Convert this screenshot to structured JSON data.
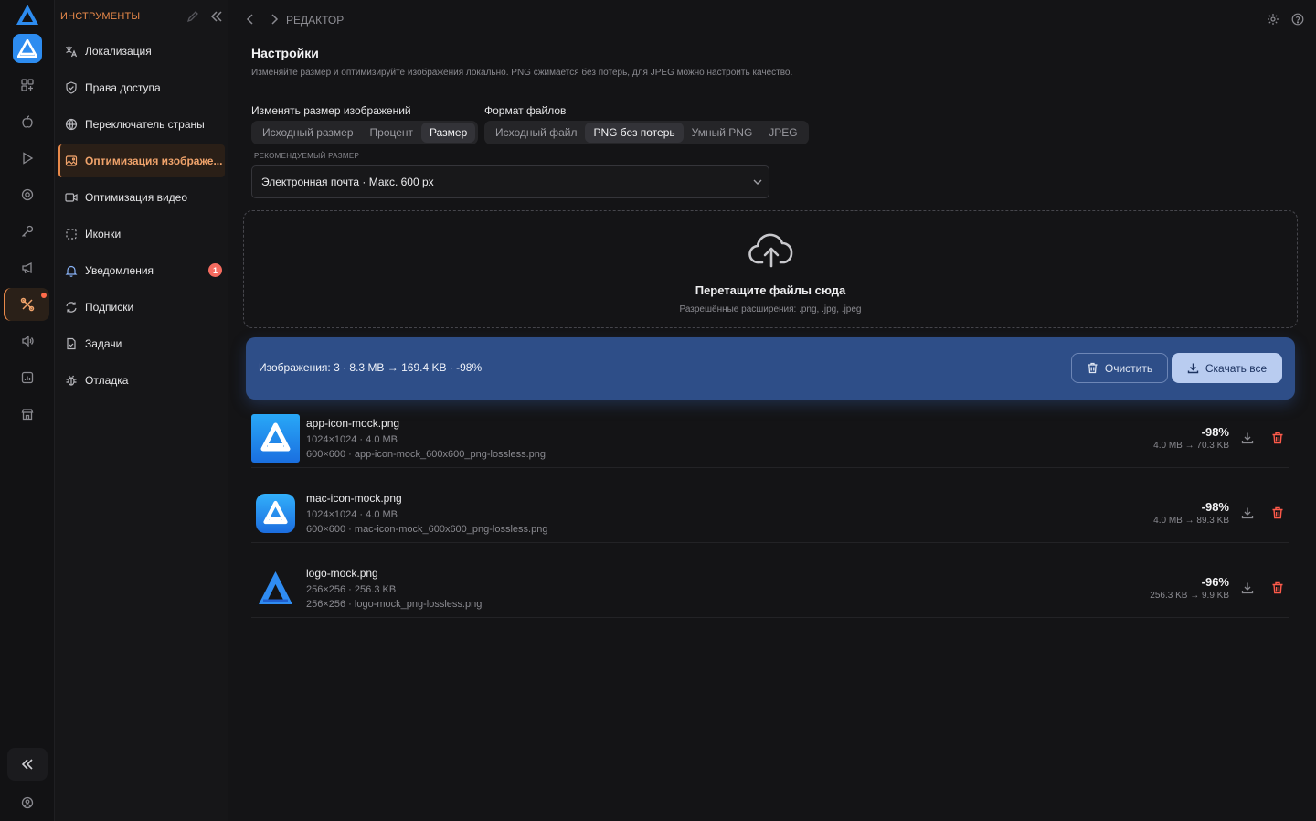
{
  "sidebar": {
    "header": "ИНСТРУМЕНТЫ",
    "items": [
      {
        "label": "Локализация",
        "icon": "translate-icon"
      },
      {
        "label": "Права доступа",
        "icon": "shield-icon"
      },
      {
        "label": "Переключатель страны",
        "icon": "globe-icon"
      },
      {
        "label": "Оптимизация изображе...",
        "icon": "image-icon",
        "active": true
      },
      {
        "label": "Оптимизация видео",
        "icon": "video-icon"
      },
      {
        "label": "Иконки",
        "icon": "icons-icon"
      },
      {
        "label": "Уведомления",
        "icon": "bell-icon",
        "badge": "1"
      },
      {
        "label": "Подписки",
        "icon": "refresh-icon"
      },
      {
        "label": "Задачи",
        "icon": "tasks-icon"
      },
      {
        "label": "Отладка",
        "icon": "bug-icon"
      }
    ]
  },
  "header": {
    "breadcrumb": "РЕДАКТОР"
  },
  "settings": {
    "title": "Настройки",
    "subtitle": "Изменяйте размер и оптимизируйте изображения локально. PNG сжимается без потерь, для JPEG можно настроить качество.",
    "resize_label": "Изменять размер изображений",
    "resize_options": [
      "Исходный размер",
      "Процент",
      "Размер"
    ],
    "resize_selected": "Размер",
    "format_label": "Формат файлов",
    "format_options": [
      "Исходный файл",
      "PNG без потерь",
      "Умный PNG",
      "JPEG"
    ],
    "format_selected": "PNG без потерь",
    "recommended_label": "РЕКОМЕНДУЕМЫЙ РАЗМЕР",
    "recommended_value": "Электронная почта · Макс. 600 px"
  },
  "dropzone": {
    "title": "Перетащите файлы сюда",
    "subtitle": "Разрешённые расширения: .png, .jpg, .jpeg"
  },
  "summary": {
    "text": "Изображения: 3 · 8.3 MB → 169.4 KB · -98%",
    "clear_label": "Очистить",
    "download_all_label": "Скачать все"
  },
  "files": [
    {
      "name": "app-icon-mock.png",
      "meta1": "1024×1024 · 4.0 MB",
      "meta2": "600×600 · app-icon-mock_600x600_png-lossless.png",
      "percent": "-98%",
      "sizes": "4.0 MB → 70.3 KB"
    },
    {
      "name": "mac-icon-mock.png",
      "meta1": "1024×1024 · 4.0 MB",
      "meta2": "600×600 · mac-icon-mock_600x600_png-lossless.png",
      "percent": "-98%",
      "sizes": "4.0 MB → 89.3 KB"
    },
    {
      "name": "logo-mock.png",
      "meta1": "256×256 · 256.3 KB",
      "meta2": "256×256 · logo-mock_png-lossless.png",
      "percent": "-96%",
      "sizes": "256.3 KB → 9.9 KB"
    }
  ],
  "colors": {
    "accent": "#e8894a",
    "summary_bg": "#2e4e88",
    "danger": "#ff5a4a",
    "brand_blue": "#2d8cf0"
  }
}
